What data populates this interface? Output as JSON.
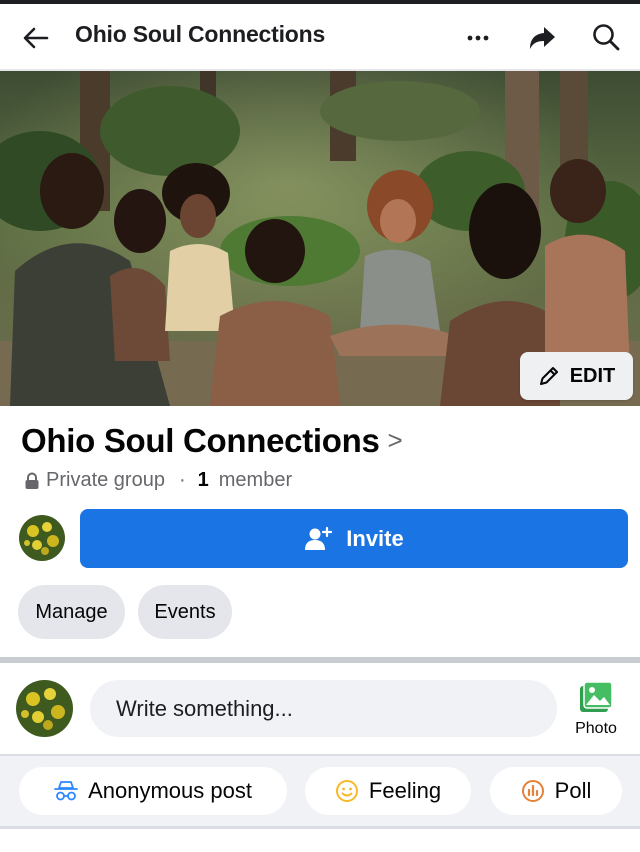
{
  "header": {
    "title": "Ohio Soul Connections",
    "icons": [
      "back-arrow-icon",
      "more-icon",
      "share-icon",
      "search-icon"
    ]
  },
  "cover": {
    "edit_label": "EDIT"
  },
  "group": {
    "name": "Ohio Soul Connections",
    "name_chevron": ">",
    "privacy": "Private group",
    "separator": "·",
    "member_count": "1",
    "member_label": "member"
  },
  "actions": {
    "invite_label": "Invite",
    "manage_label": "Manage",
    "events_label": "Events"
  },
  "composer": {
    "placeholder": "Write something...",
    "photo_label": "Photo"
  },
  "post_options": [
    {
      "label": "Anonymous post",
      "icon": "anonymous-icon"
    },
    {
      "label": "Feeling",
      "icon": "smiley-icon"
    },
    {
      "label": "Poll",
      "icon": "poll-icon"
    }
  ],
  "colors": {
    "primary": "#1b74e4",
    "photo_green": "#45bd62",
    "feeling_yellow": "#f7b928",
    "poll_orange": "#e4813b",
    "anon_blue": "#2d88ff"
  }
}
